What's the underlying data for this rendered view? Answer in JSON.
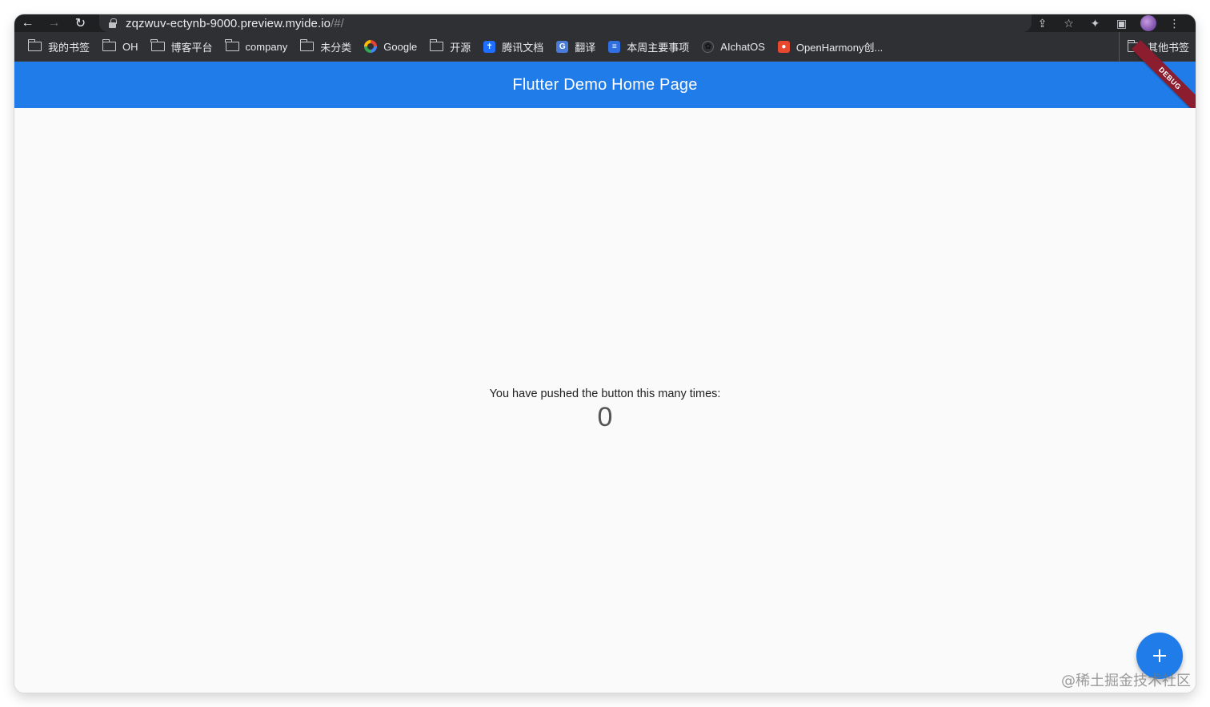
{
  "browser": {
    "url_host": "zqzwuv-ectynb-9000.preview.myide.io",
    "url_rest": "/#/"
  },
  "bookmarks": {
    "items": [
      {
        "label": "我的书签",
        "icon": "folder-icon"
      },
      {
        "label": "OH",
        "icon": "folder-icon"
      },
      {
        "label": "博客平台",
        "icon": "folder-icon"
      },
      {
        "label": "company",
        "icon": "folder-icon"
      },
      {
        "label": "未分类",
        "icon": "folder-icon"
      },
      {
        "label": "Google",
        "icon": "google-icon"
      },
      {
        "label": "开源",
        "icon": "folder-icon"
      },
      {
        "label": "腾讯文档",
        "icon": "tencent-docs-icon"
      },
      {
        "label": "翻译",
        "icon": "translate-icon"
      },
      {
        "label": "本周主要事项",
        "icon": "doc-icon"
      },
      {
        "label": "AIchatOS",
        "icon": "openai-icon"
      },
      {
        "label": "OpenHarmony创...",
        "icon": "openharmony-icon"
      }
    ],
    "other": "其他书签"
  },
  "app": {
    "title": "Flutter Demo Home Page",
    "debug_label": "DEBUG",
    "counter_label": "You have pushed the button this many times:",
    "counter_value": "0",
    "primary_color": "#1f7ce8"
  },
  "watermark": "@稀土掘金技术社区"
}
